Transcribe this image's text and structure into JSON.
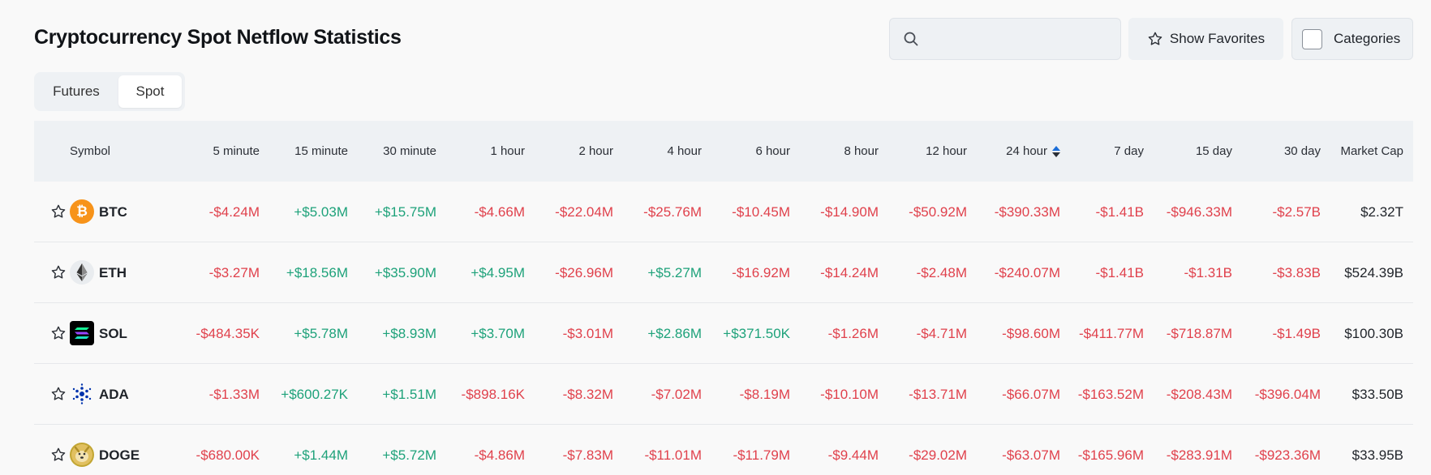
{
  "header": {
    "title": "Cryptocurrency Spot Netflow Statistics",
    "search_placeholder": "",
    "show_favorites_label": "Show Favorites",
    "categories_label": "Categories"
  },
  "tabs": [
    {
      "label": "Futures",
      "active": false
    },
    {
      "label": "Spot",
      "active": true
    }
  ],
  "table": {
    "columns": [
      "Symbol",
      "5 minute",
      "15 minute",
      "30 minute",
      "1 hour",
      "2 hour",
      "4 hour",
      "6 hour",
      "8 hour",
      "12 hour",
      "24 hour",
      "7 day",
      "15 day",
      "30 day",
      "Market Cap"
    ],
    "sorted_column": "24 hour",
    "rows": [
      {
        "symbol": "BTC",
        "icon": "bitcoin-icon",
        "values": [
          "-$4.24M",
          "+$5.03M",
          "+$15.75M",
          "-$4.66M",
          "-$22.04M",
          "-$25.76M",
          "-$10.45M",
          "-$14.90M",
          "-$50.92M",
          "-$390.33M",
          "-$1.41B",
          "-$946.33M",
          "-$2.57B"
        ],
        "market_cap": "$2.32T"
      },
      {
        "symbol": "ETH",
        "icon": "ethereum-icon",
        "values": [
          "-$3.27M",
          "+$18.56M",
          "+$35.90M",
          "+$4.95M",
          "-$26.96M",
          "+$5.27M",
          "-$16.92M",
          "-$14.24M",
          "-$2.48M",
          "-$240.07M",
          "-$1.41B",
          "-$1.31B",
          "-$3.83B"
        ],
        "market_cap": "$524.39B"
      },
      {
        "symbol": "SOL",
        "icon": "solana-icon",
        "values": [
          "-$484.35K",
          "+$5.78M",
          "+$8.93M",
          "+$3.70M",
          "-$3.01M",
          "+$2.86M",
          "+$371.50K",
          "-$1.26M",
          "-$4.71M",
          "-$98.60M",
          "-$411.77M",
          "-$718.87M",
          "-$1.49B"
        ],
        "market_cap": "$100.30B"
      },
      {
        "symbol": "ADA",
        "icon": "cardano-icon",
        "values": [
          "-$1.33M",
          "+$600.27K",
          "+$1.51M",
          "-$898.16K",
          "-$8.32M",
          "-$7.02M",
          "-$8.19M",
          "-$10.10M",
          "-$13.71M",
          "-$66.07M",
          "-$163.52M",
          "-$208.43M",
          "-$396.04M"
        ],
        "market_cap": "$33.50B"
      },
      {
        "symbol": "DOGE",
        "icon": "dogecoin-icon",
        "values": [
          "-$680.00K",
          "+$1.44M",
          "+$5.72M",
          "-$4.86M",
          "-$7.83M",
          "-$11.01M",
          "-$11.79M",
          "-$9.44M",
          "-$29.02M",
          "-$63.07M",
          "-$165.96M",
          "-$283.91M",
          "-$923.36M"
        ],
        "market_cap": "$33.95B"
      }
    ]
  },
  "colors": {
    "negative": "#e0414c",
    "positive": "#1ea27a",
    "sort_active": "#1c6ed8"
  }
}
